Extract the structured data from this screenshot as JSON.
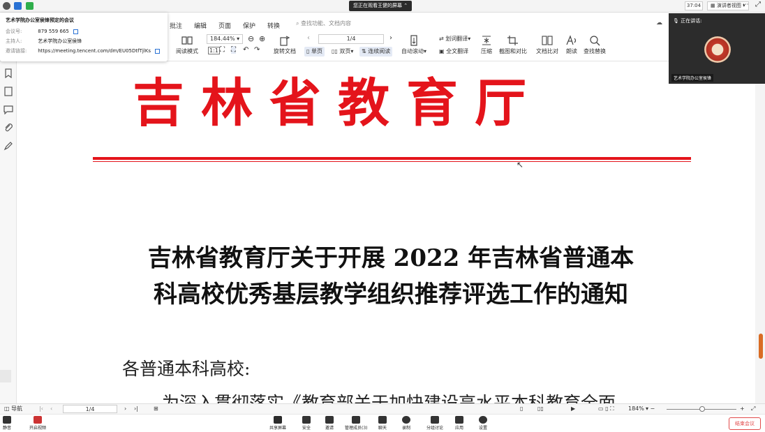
{
  "top_bar": {
    "share_banner": "您正在观看王健的屏幕",
    "timer": "37:04",
    "view_mode": "演讲者视图"
  },
  "meeting_info": {
    "title": "艺术学院办公室侯锋预定的会议",
    "meeting_id_label": "会议号:",
    "meeting_id": "879 559 665",
    "host_label": "主持人:",
    "host": "艺术学院办公室侯锋",
    "invite_label": "邀请链接:",
    "invite_link": "https://meeting.tencent.com/dm/EU05DtfTjlKs"
  },
  "pdf_toolbar": {
    "menu_tabs": [
      "批注",
      "编辑",
      "页面",
      "保护",
      "转换"
    ],
    "search_placeholder": "查找功能、文档内容",
    "zoom": "184.44%",
    "page_indicator": "1/4",
    "tools": {
      "read_mode": "阅读模式",
      "rotate": "旋转文档",
      "single_page": "单页",
      "double_page": "双页",
      "continuous": "连续阅读",
      "auto_scroll": "自动滚动",
      "word_translate": "划词翻译",
      "full_translate": "全文翻译",
      "compress": "压缩",
      "screenshot_compare": "截图和对比",
      "doc_compare": "文档比对",
      "read_aloud": "朗读",
      "find_replace": "查找替换"
    }
  },
  "video_panel": {
    "speaking_label": "正在讲话:",
    "speaker_name": "艺术学院办公室侯锋"
  },
  "document": {
    "header": "吉林省教育厅",
    "title_line_1": "吉林省教育厅关于开展 2022 年吉林省普通本",
    "title_line_2": "科高校优秀基层教学组织推荐评选工作的通知",
    "greeting": "各普通本科高校:",
    "body_partial": "为深入贯彻落实《教育部关于加快建设高水平本科教育全面"
  },
  "status_bar": {
    "nav_label": "导航",
    "page": "1/4",
    "zoom": "184%"
  },
  "meeting_bar": {
    "mute": "静音",
    "video": "开启视频",
    "share": "共享屏幕",
    "security": "安全",
    "invite": "邀请",
    "members": "管理成员(3)",
    "chat": "聊天",
    "record": "录制",
    "breakout": "分组讨论",
    "apps": "应用",
    "settings": "设置",
    "end": "结束会议"
  },
  "colors": {
    "header_red": "#e4141b",
    "accent_orange": "#d96c24",
    "end_red": "#e24a4a"
  }
}
